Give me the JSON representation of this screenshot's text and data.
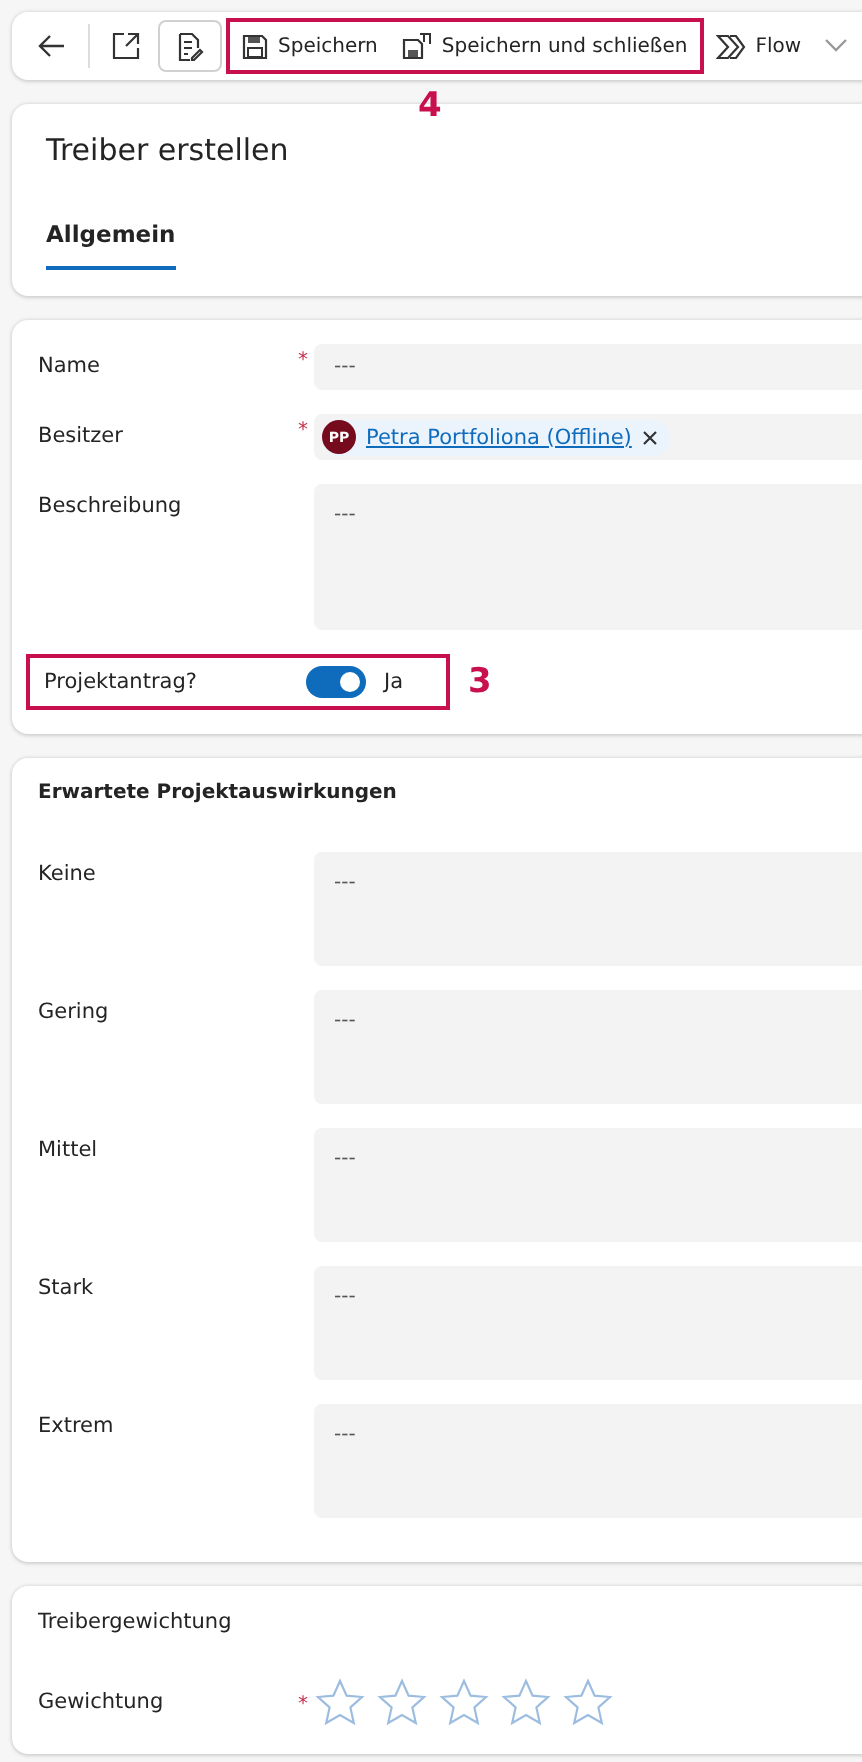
{
  "toolbar": {
    "buttons": [
      {
        "kind": "save",
        "label": "Speichern"
      },
      {
        "kind": "save-close",
        "label": "Speichern und schließen"
      },
      {
        "kind": "flow",
        "label": "Flow"
      }
    ],
    "annotation": "4"
  },
  "header": {
    "title": "Treiber erstellen",
    "tabs": [
      {
        "label": "Allgemein",
        "selected": true
      }
    ]
  },
  "general": {
    "fields": [
      {
        "kind": "text",
        "label": "Name",
        "required_mark": "*",
        "value": "---"
      },
      {
        "kind": "lookup",
        "label": "Besitzer",
        "required_mark": "*",
        "initials": "PP",
        "value": "Petra Portfoliona (Offline)"
      },
      {
        "kind": "textarea",
        "label": "Beschreibung",
        "value": "---"
      },
      {
        "kind": "toggle",
        "label": "Projektantrag?",
        "on": true,
        "value": "Ja",
        "annotation": "3"
      }
    ]
  },
  "impact": {
    "title": "Erwartete Projektauswirkungen",
    "fields": [
      {
        "label": "Keine",
        "value": "---"
      },
      {
        "label": "Gering",
        "value": "---"
      },
      {
        "label": "Mittel",
        "value": "---"
      },
      {
        "label": "Stark",
        "value": "---"
      },
      {
        "label": "Extrem",
        "value": "---"
      }
    ]
  },
  "weighting": {
    "title": "Treibergewichtung",
    "label": "Gewichtung",
    "required_mark": "*",
    "stars": 0
  }
}
